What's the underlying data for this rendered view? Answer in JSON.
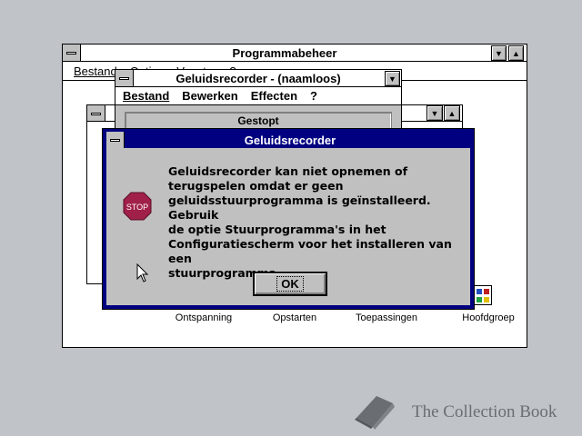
{
  "program_manager": {
    "title": "Programmabeheer",
    "menu": [
      "Bestand",
      "Opties",
      "Venster",
      "?"
    ],
    "groups": [
      "Ontspanning",
      "Opstarten",
      "Toepassingen",
      "Hoofdgroep"
    ]
  },
  "sound_recorder": {
    "title": "Geluidsrecorder - (naamloos)",
    "menu": [
      "Bestand",
      "Bewerken",
      "Effecten",
      "?"
    ],
    "status": "Gestopt"
  },
  "dialog": {
    "title": "Geluidsrecorder",
    "icon_label": "STOP",
    "message": [
      "Geluidsrecorder kan niet opnemen of",
      "terugspelen omdat er geen",
      "geluidsstuurprogramma is geïnstalleerd. Gebruik",
      "de optie Stuurprogramma's in het",
      "Configuratiescherm voor het installeren van een",
      "stuurprogramma."
    ],
    "ok_label": "OK"
  },
  "watermark": {
    "text": "The Collection Book"
  },
  "colors": {
    "desktop": "#c0c4c8",
    "active_title": "#000080",
    "face": "#c0c0c0",
    "stop_sign": "#a0204a"
  },
  "icons": [
    "system-menu-icon",
    "minimize-icon",
    "maximize-icon",
    "stop-icon",
    "mouse-pointer-icon",
    "book-icon"
  ]
}
